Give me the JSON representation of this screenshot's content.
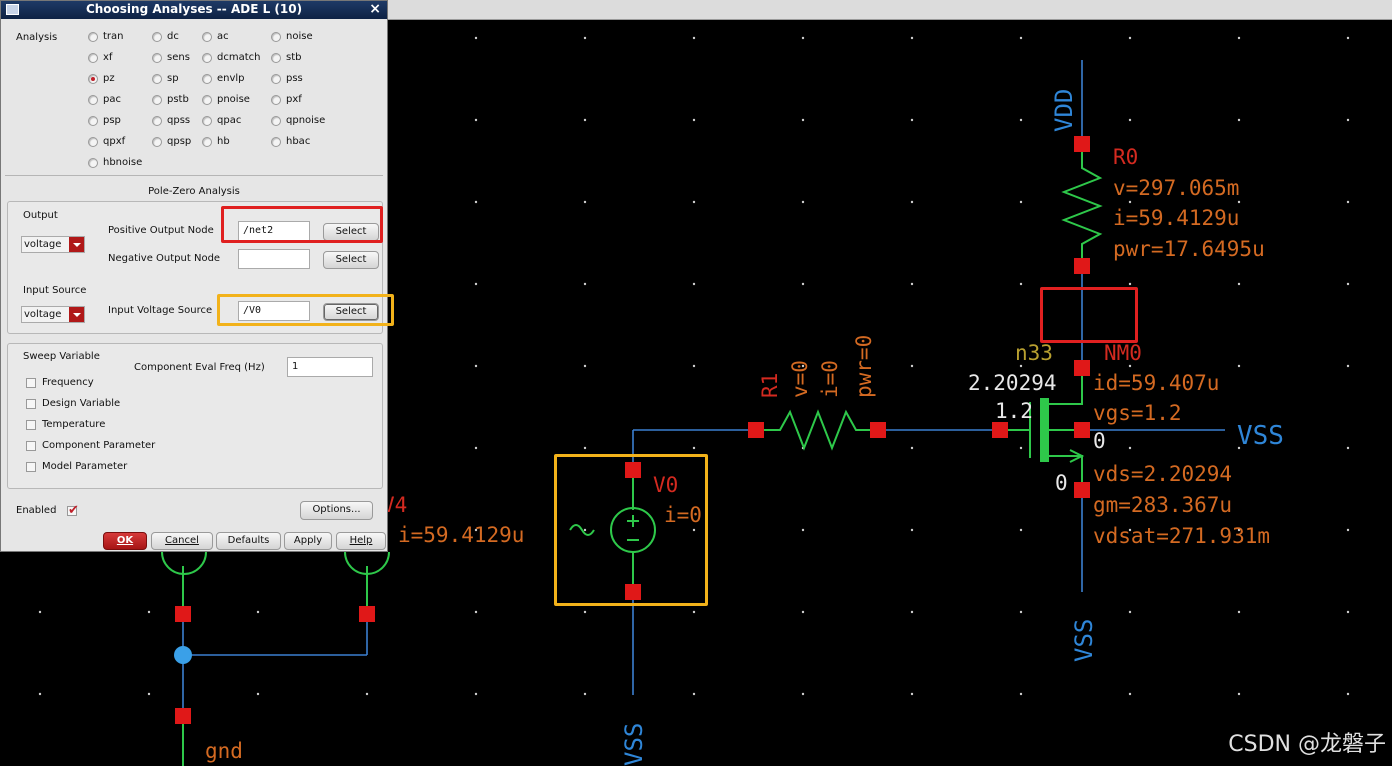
{
  "dialog": {
    "title": "Choosing Analyses -- ADE L (10)",
    "close_glyph": "×",
    "analysis_label": "Analysis",
    "analyses": [
      {
        "label": "tran",
        "selected": false
      },
      {
        "label": "dc",
        "selected": false
      },
      {
        "label": "ac",
        "selected": false
      },
      {
        "label": "noise",
        "selected": false
      },
      {
        "label": "xf",
        "selected": false
      },
      {
        "label": "sens",
        "selected": false
      },
      {
        "label": "dcmatch",
        "selected": false
      },
      {
        "label": "stb",
        "selected": false
      },
      {
        "label": "pz",
        "selected": true
      },
      {
        "label": "sp",
        "selected": false
      },
      {
        "label": "envlp",
        "selected": false
      },
      {
        "label": "pss",
        "selected": false
      },
      {
        "label": "pac",
        "selected": false
      },
      {
        "label": "pstb",
        "selected": false
      },
      {
        "label": "pnoise",
        "selected": false
      },
      {
        "label": "pxf",
        "selected": false
      },
      {
        "label": "psp",
        "selected": false
      },
      {
        "label": "qpss",
        "selected": false
      },
      {
        "label": "qpac",
        "selected": false
      },
      {
        "label": "qpnoise",
        "selected": false
      },
      {
        "label": "qpxf",
        "selected": false
      },
      {
        "label": "qpsp",
        "selected": false
      },
      {
        "label": "hb",
        "selected": false
      },
      {
        "label": "hbac",
        "selected": false
      },
      {
        "label": "hbnoise",
        "selected": false
      }
    ],
    "section_title": "Pole-Zero Analysis",
    "output": {
      "label": "Output",
      "type": "voltage",
      "positive_label": "Positive Output Node",
      "positive_value": "/net2",
      "negative_label": "Negative Output Node",
      "negative_value": "",
      "select_label": "Select"
    },
    "input": {
      "label": "Input Source",
      "type": "voltage",
      "voltage_source_label": "Input Voltage Source",
      "voltage_source_value": "/V0",
      "select_label": "Select"
    },
    "sweep": {
      "label": "Sweep Variable",
      "options": [
        "Frequency",
        "Design Variable",
        "Temperature",
        "Component Parameter",
        "Model Parameter"
      ],
      "eval_freq_label": "Component Eval Freq (Hz)",
      "eval_freq_value": "1"
    },
    "enabled_label": "Enabled",
    "enabled": true,
    "options_button": "Options...",
    "buttons": {
      "ok": "OK",
      "cancel": "Cancel",
      "defaults": "Defaults",
      "apply": "Apply",
      "help": "Help"
    }
  },
  "schematic": {
    "vdd_label": "VDD",
    "r0": {
      "name": "R0",
      "v": "v=297.065m",
      "i": "i=59.4129u",
      "pwr": "pwr=17.6495u"
    },
    "nm0": {
      "model": "n33",
      "name": "NM0",
      "vg_node": "2.20294",
      "vgs_node": "1.2",
      "bulk": "0",
      "source_node": "0",
      "id": "id=59.407u",
      "vgs": "vgs=1.2",
      "vds": "vds=2.20294",
      "gm": "gm=283.367u",
      "vdsat": "vdsat=271.931m"
    },
    "vss_labels": [
      "VSS",
      "VSS",
      "VSS"
    ],
    "r1": {
      "name": "R1",
      "v": "v=0",
      "i": "i=0",
      "pwr": "pwr=0"
    },
    "v0": {
      "name": "V0",
      "i": "i=0"
    },
    "v4": {
      "name_fragment": "V4",
      "i": "i=59.4129u"
    },
    "gnd_label": "gnd",
    "watermark": "CSDN @龙磐子"
  },
  "colors": {
    "wire": "#3b7fd0",
    "pin": "#e01818",
    "component": "#2ec84a",
    "label_orange": "#d46a22",
    "label_red": "#d42a20",
    "net_blue": "#2f86d8",
    "highlight_red": "#e02020",
    "highlight_orange": "#f2b21a"
  }
}
